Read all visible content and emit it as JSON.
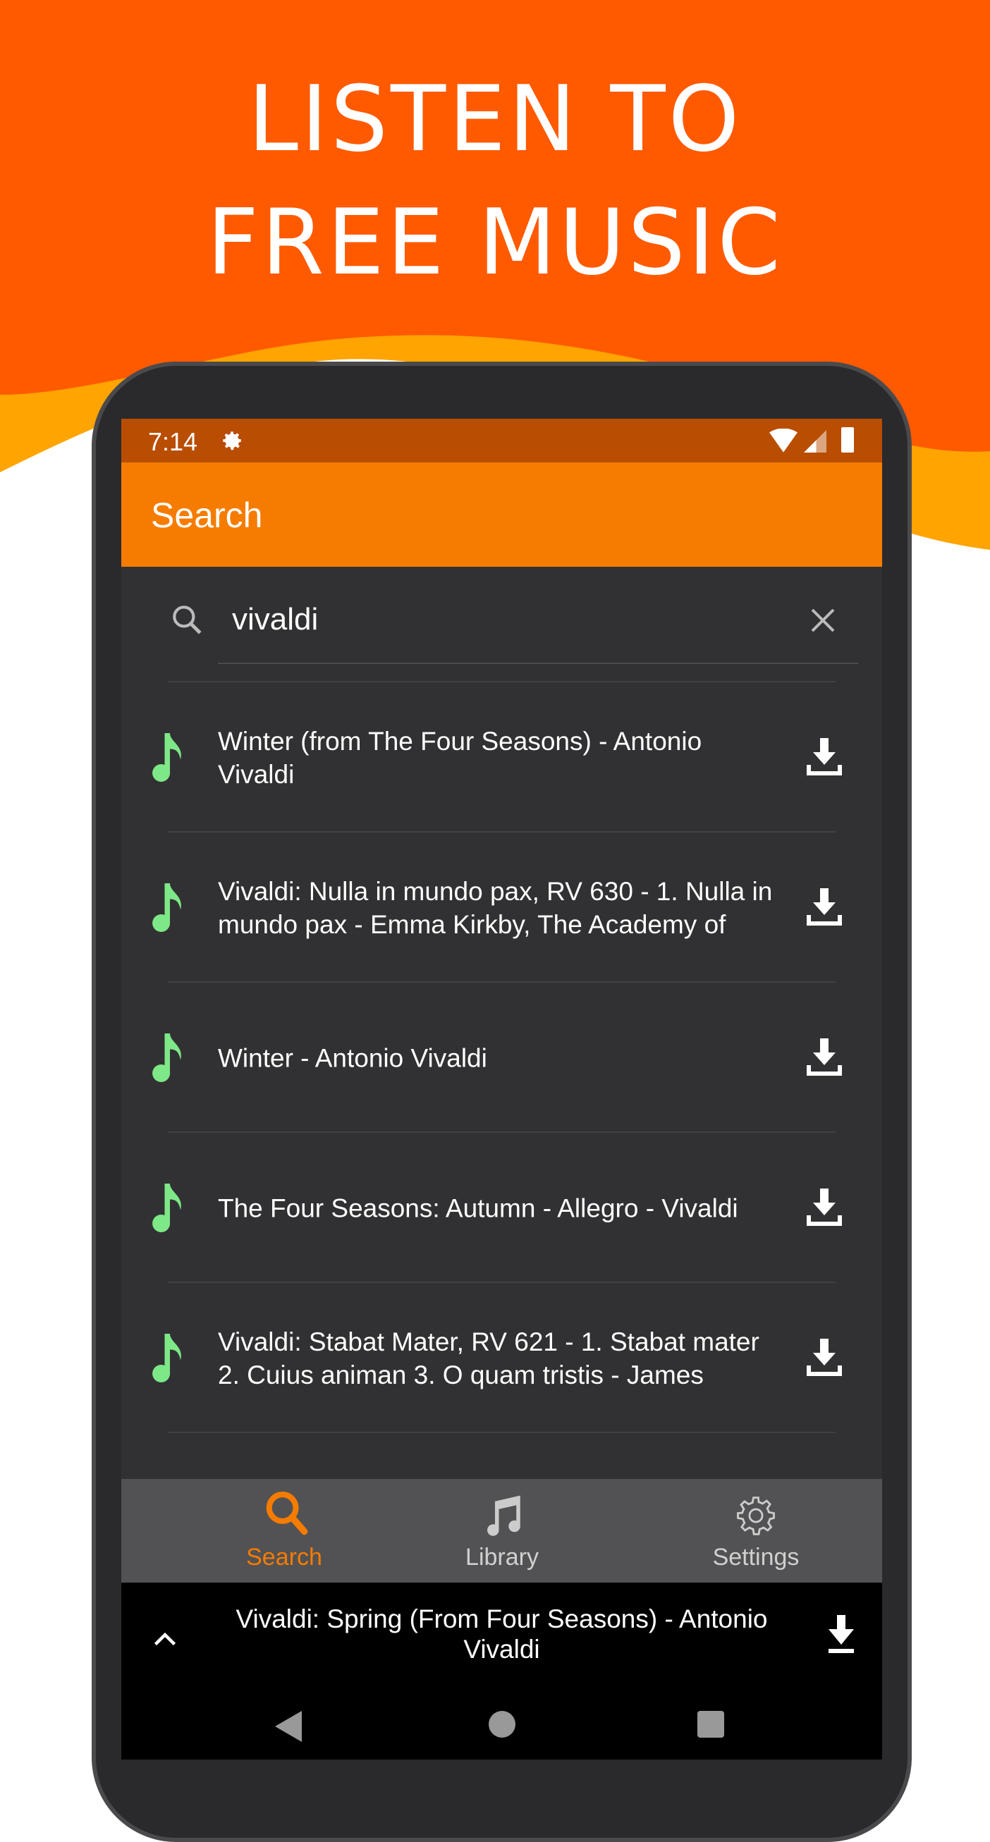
{
  "promo": {
    "line1": "LISTEN TO",
    "line2": "FREE MUSIC",
    "brand_color": "#ff5a00"
  },
  "status_bar": {
    "time": "7:14",
    "icons": [
      "gear-icon",
      "wifi-icon",
      "signal-icon",
      "battery-icon"
    ]
  },
  "app_bar": {
    "title": "Search",
    "color": "#f57c00"
  },
  "search": {
    "value": "vivaldi",
    "icon": "search-icon",
    "clear_icon": "close-icon"
  },
  "results": [
    {
      "title": "Winter (from The Four Seasons) - Antonio Vivaldi"
    },
    {
      "title": "Vivaldi: Nulla in mundo pax, RV 630 - 1. Nulla in mundo pax - Emma Kirkby, The Academy of"
    },
    {
      "title": "Winter - Antonio Vivaldi"
    },
    {
      "title": "The Four Seasons: Autumn - Allegro - Vivaldi"
    },
    {
      "title": "Vivaldi: Stabat Mater, RV 621 - 1. Stabat mater 2. Cuius animan 3. O quam tristis - James"
    }
  ],
  "note_color": "#7ee787",
  "bottom_nav": {
    "items": [
      {
        "label": "Search",
        "active": true
      },
      {
        "label": "Library",
        "active": false
      },
      {
        "label": "Settings",
        "active": false
      }
    ]
  },
  "player": {
    "title": "Vivaldi: Spring (From Four Seasons) - Antonio Vivaldi"
  }
}
